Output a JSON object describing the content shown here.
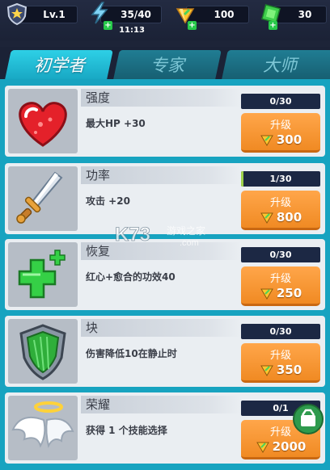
{
  "topbar": {
    "level": "Lv.1",
    "energy": "35/40",
    "timer": "11:13",
    "gems": "100",
    "cash": "30",
    "icons": [
      "shield-level-icon",
      "lightning-energy-icon",
      "gem-icon",
      "green-cash-icon"
    ]
  },
  "tabs": [
    {
      "label": "初学者",
      "active": true
    },
    {
      "label": "专家",
      "active": false
    },
    {
      "label": "大师",
      "active": false
    }
  ],
  "skills": [
    {
      "title": "强度",
      "desc": "最大HP +30",
      "progress": "0/30",
      "fill": 0.0,
      "button": "升级",
      "cost": "300",
      "icon": "heart-icon"
    },
    {
      "title": "功率",
      "desc": "攻击 +20",
      "progress": "1/30",
      "fill": 0.0333,
      "button": "升级",
      "cost": "800",
      "icon": "sword-icon"
    },
    {
      "title": "恢复",
      "desc": "红心+愈合的功效40",
      "progress": "0/30",
      "fill": 0.0,
      "button": "升级",
      "cost": "250",
      "icon": "health-cross-icon"
    },
    {
      "title": "块",
      "desc": "伤害降低10在静止时",
      "progress": "0/30",
      "fill": 0.0,
      "button": "升级",
      "cost": "350",
      "icon": "shield-block-icon"
    },
    {
      "title": "荣耀",
      "desc": "获得 1 个技能选择",
      "progress": "0/1",
      "fill": 0.0,
      "button": "升级",
      "cost": "2000",
      "icon": "angel-wings-icon"
    }
  ],
  "watermark": {
    "logo": "K73",
    "sub": "游戏之家",
    "url": ".com"
  },
  "colors": {
    "panel": "#17a3c0",
    "tab_active": "#2ed0e6",
    "button": "#f08a23",
    "progress_bar": "#1c2844",
    "progress_fill": "#9ed24a"
  }
}
